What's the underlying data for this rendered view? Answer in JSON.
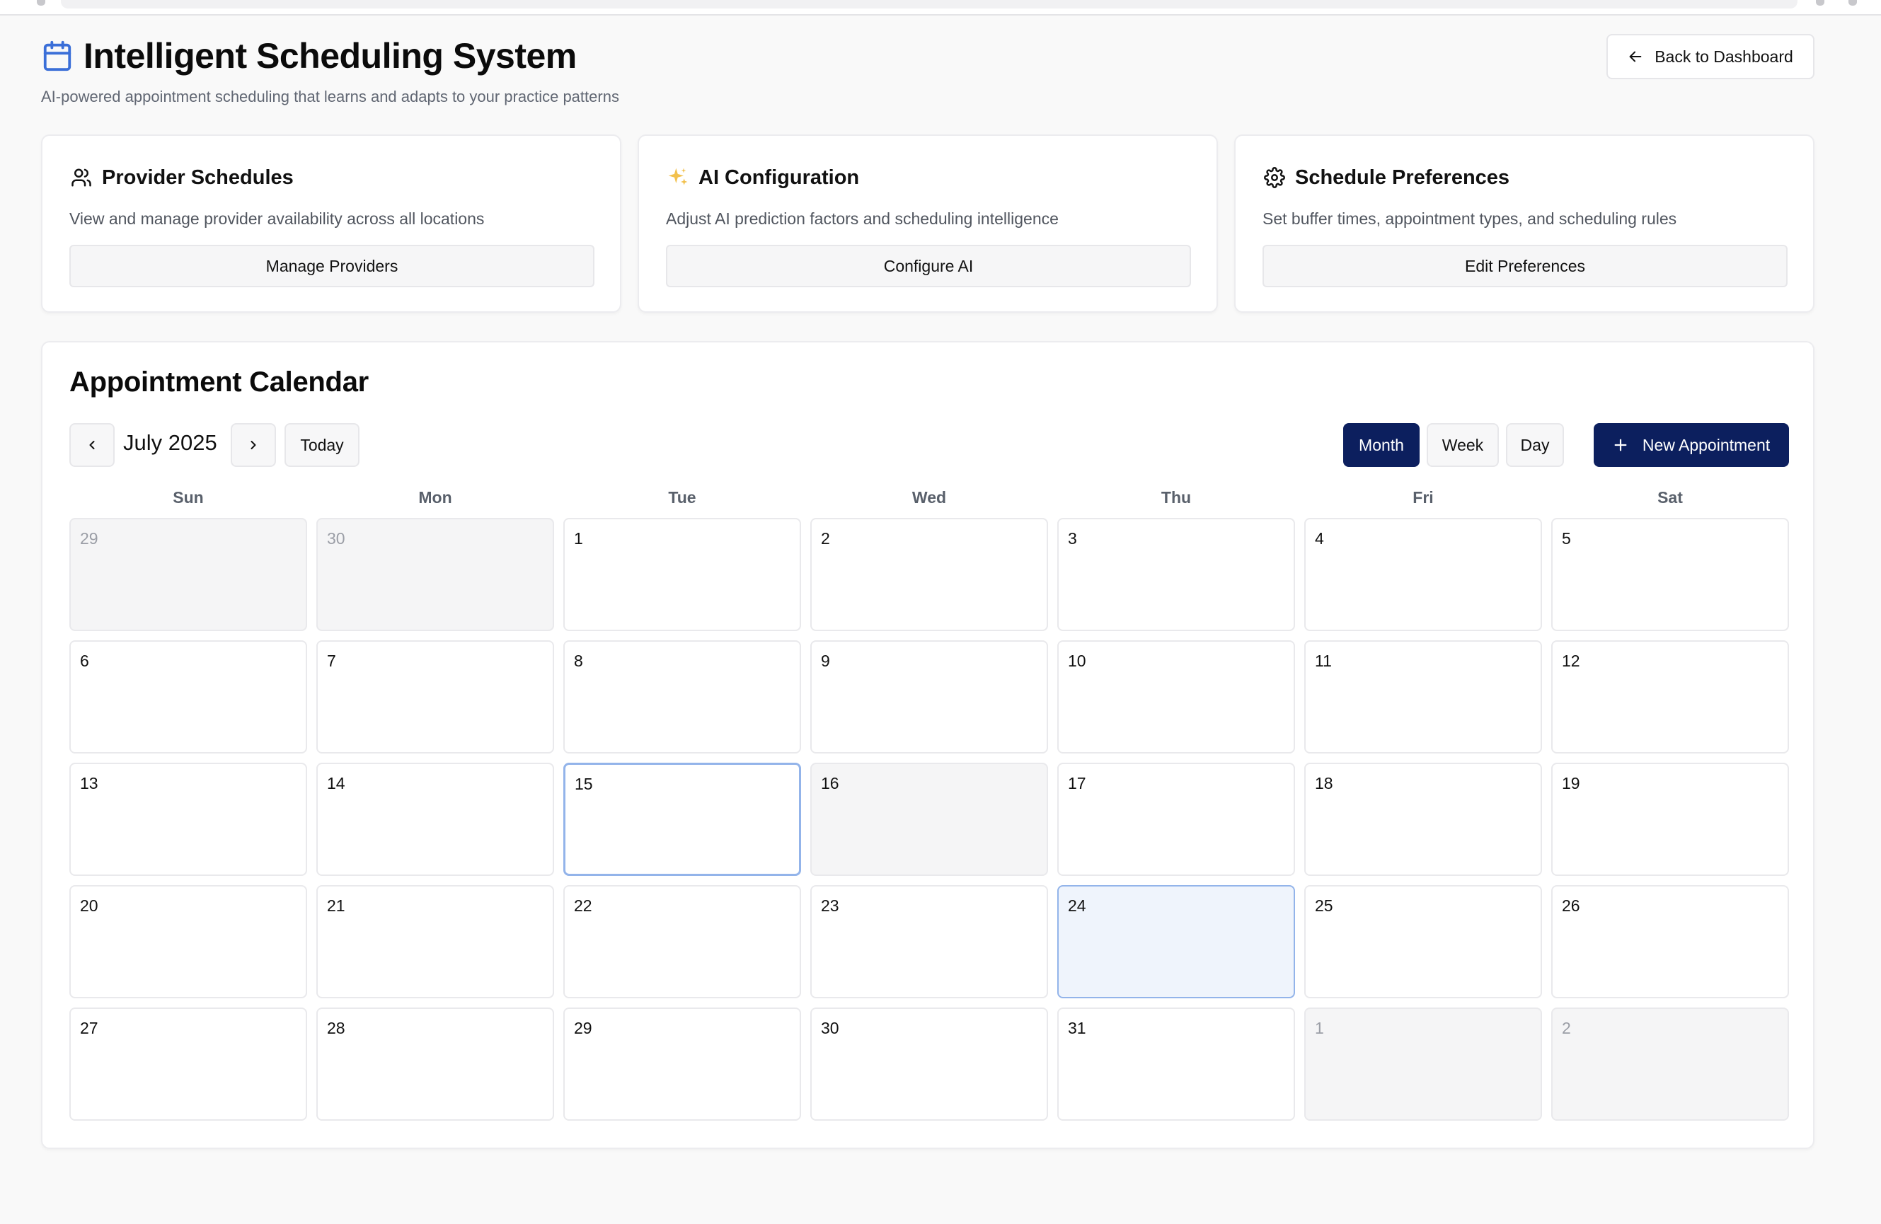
{
  "header": {
    "title": "Intelligent Scheduling System",
    "subtitle": "AI-powered appointment scheduling that learns and adapts to your practice patterns",
    "back_label": "Back to Dashboard"
  },
  "cards": [
    {
      "icon": "users-icon",
      "title": "Provider Schedules",
      "description": "View and manage provider availability across all locations",
      "button": "Manage Providers"
    },
    {
      "icon": "sparkles-icon",
      "title": "AI Configuration",
      "description": "Adjust AI prediction factors and scheduling intelligence",
      "button": "Configure AI"
    },
    {
      "icon": "gear-icon",
      "title": "Schedule Preferences",
      "description": "Set buffer times, appointment types, and scheduling rules",
      "button": "Edit Preferences"
    }
  ],
  "calendar": {
    "title": "Appointment Calendar",
    "month_label": "July 2025",
    "today_label": "Today",
    "views": [
      "Month",
      "Week",
      "Day"
    ],
    "active_view": "Month",
    "new_label": "New Appointment",
    "weekdays": [
      "Sun",
      "Mon",
      "Tue",
      "Wed",
      "Thu",
      "Fri",
      "Sat"
    ],
    "days": [
      {
        "n": "29",
        "state": "other"
      },
      {
        "n": "30",
        "state": "other"
      },
      {
        "n": "1"
      },
      {
        "n": "2"
      },
      {
        "n": "3"
      },
      {
        "n": "4"
      },
      {
        "n": "5"
      },
      {
        "n": "6"
      },
      {
        "n": "7"
      },
      {
        "n": "8"
      },
      {
        "n": "9"
      },
      {
        "n": "10"
      },
      {
        "n": "11"
      },
      {
        "n": "12"
      },
      {
        "n": "13"
      },
      {
        "n": "14"
      },
      {
        "n": "15",
        "state": "selected"
      },
      {
        "n": "16",
        "state": "grayed"
      },
      {
        "n": "17"
      },
      {
        "n": "18"
      },
      {
        "n": "19"
      },
      {
        "n": "20"
      },
      {
        "n": "21"
      },
      {
        "n": "22"
      },
      {
        "n": "23"
      },
      {
        "n": "24",
        "state": "today"
      },
      {
        "n": "25"
      },
      {
        "n": "26"
      },
      {
        "n": "27"
      },
      {
        "n": "28"
      },
      {
        "n": "29"
      },
      {
        "n": "30"
      },
      {
        "n": "31"
      },
      {
        "n": "1",
        "state": "other"
      },
      {
        "n": "2",
        "state": "other"
      }
    ]
  },
  "colors": {
    "accent": "#0c1f5e",
    "calendar_icon": "#3b6fd8",
    "sparkle": "#f2c14e",
    "selected_border": "#93b4ea"
  }
}
